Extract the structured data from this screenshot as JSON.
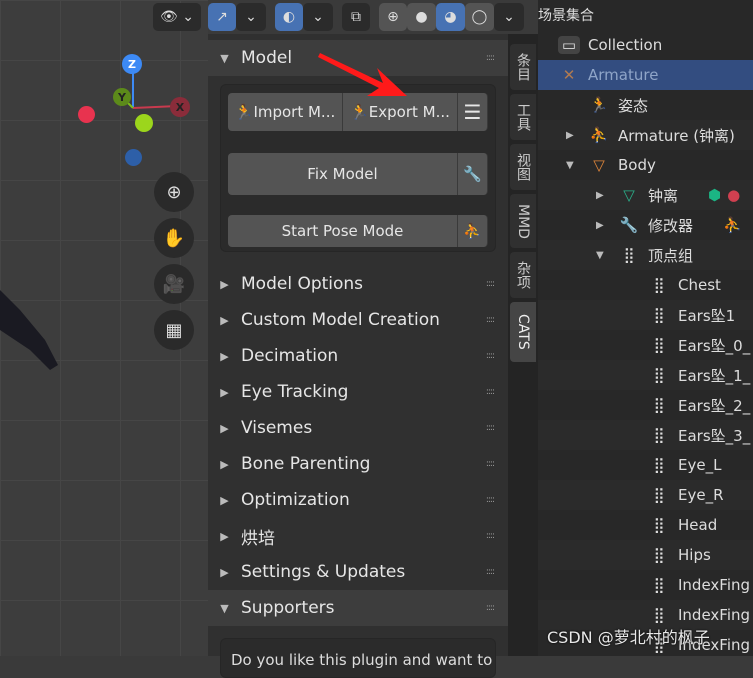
{
  "viewport": {
    "axes": {
      "z": "Z",
      "y": "Y",
      "x": "X"
    },
    "nav_icons": [
      "zoom-icon",
      "hand-pan-icon",
      "camera-icon",
      "grid-ortho-icon"
    ]
  },
  "topbar": {
    "icons": [
      "visibility-eye-icon",
      "gizmo-icon",
      "overlay-icon",
      "xray-icon",
      "wireframe-shading-icon",
      "solid-shading-icon",
      "material-shading-icon",
      "rendered-shading-icon"
    ]
  },
  "panel": {
    "model_header": "Model",
    "import_label": "Import M...",
    "export_label": "Export M...",
    "fix_model_label": "Fix Model",
    "start_pose_label": "Start Pose Mode",
    "sections": [
      "Model Options",
      "Custom Model Creation",
      "Decimation",
      "Eye Tracking",
      "Visemes",
      "Bone Parenting",
      "Optimization",
      "烘培",
      "Settings & Updates"
    ],
    "supporters_header": "Supporters",
    "supporters_text": "Do you like this plugin and want to support?"
  },
  "tabs": [
    "条目",
    "工具",
    "视图",
    "MMD",
    "杂项",
    "CATS"
  ],
  "active_tab": "CATS",
  "outliner": {
    "title": "场景集合",
    "rows": [
      {
        "label": "Collection",
        "icon": "collection-icon",
        "indent": 0
      },
      {
        "label": "Armature",
        "icon": "armature-icon",
        "indent": 0,
        "selected": true
      },
      {
        "label": "姿态",
        "icon": "pose-icon",
        "indent": 1
      },
      {
        "label": "Armature (钟离)",
        "icon": "armature-data-icon",
        "indent": 1
      },
      {
        "label": "Body",
        "icon": "mesh-object-icon",
        "indent": 1
      },
      {
        "label": "钟离",
        "icon": "mesh-data-icon",
        "indent": 2
      },
      {
        "label": "修改器",
        "icon": "wrench-icon",
        "indent": 2
      },
      {
        "label": "顶点组",
        "icon": "vertex-groups-icon",
        "indent": 2
      },
      {
        "label": "Chest",
        "indent": 3
      },
      {
        "label": "Ears坠1",
        "indent": 3
      },
      {
        "label": "Ears坠_0_",
        "indent": 3
      },
      {
        "label": "Ears坠_1_",
        "indent": 3
      },
      {
        "label": "Ears坠_2_",
        "indent": 3
      },
      {
        "label": "Ears坠_3_",
        "indent": 3
      },
      {
        "label": "Eye_L",
        "indent": 3
      },
      {
        "label": "Eye_R",
        "indent": 3
      },
      {
        "label": "Head",
        "indent": 3
      },
      {
        "label": "Hips",
        "indent": 3
      },
      {
        "label": "IndexFing",
        "indent": 3
      },
      {
        "label": "IndexFing",
        "indent": 3
      },
      {
        "label": "IndexFing",
        "indent": 3
      }
    ]
  },
  "watermark": "CSDN @萝北村的枫子",
  "colors": {
    "accent": "#4772b3",
    "arrow": "#ff1a1a",
    "x_axis": "#c83a4e",
    "y_axis": "#7fbf1a",
    "z_axis": "#3d8af5"
  }
}
